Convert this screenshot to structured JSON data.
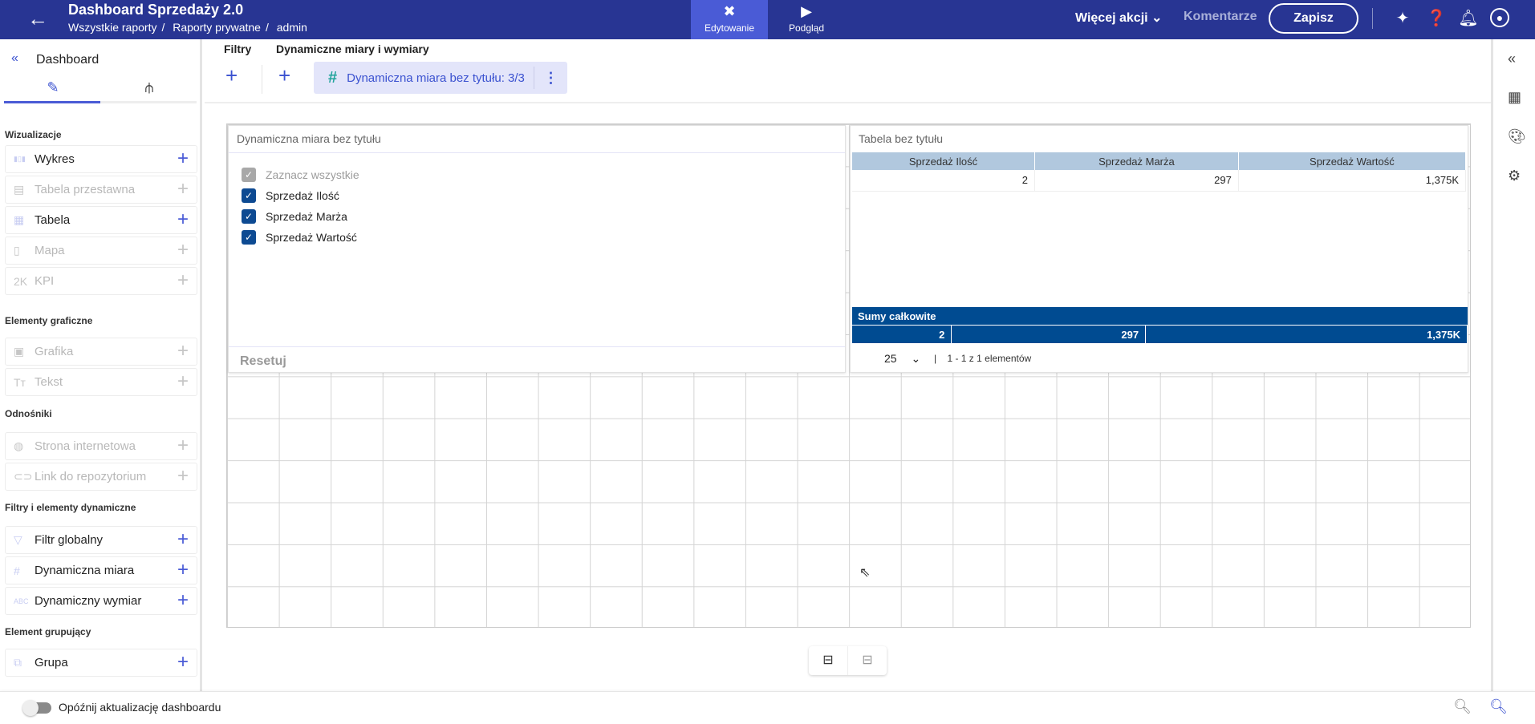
{
  "header": {
    "title": "Dashboard Sprzedaży 2.0",
    "breadcrumb": [
      "Wszystkie raporty",
      "Raporty prywatne",
      "admin"
    ],
    "tabs": [
      {
        "label": "Edytowanie",
        "icon": "edit-tools-icon"
      },
      {
        "label": "Podgląd",
        "icon": "play-icon"
      }
    ],
    "more_actions": "Więcej akcji",
    "comments": "Komentarze",
    "save": "Zapisz"
  },
  "sidebar": {
    "title": "Dashboard",
    "sections": [
      {
        "title": "Wizualizacje",
        "items": [
          {
            "label": "Wykres",
            "enabled": true
          },
          {
            "label": "Tabela przestawna",
            "enabled": false
          },
          {
            "label": "Tabela",
            "enabled": true
          },
          {
            "label": "Mapa",
            "enabled": false
          },
          {
            "label": "KPI",
            "enabled": false
          }
        ]
      },
      {
        "title": "Elementy graficzne",
        "items": [
          {
            "label": "Grafika",
            "enabled": false
          },
          {
            "label": "Tekst",
            "enabled": false
          }
        ]
      },
      {
        "title": "Odnośniki",
        "items": [
          {
            "label": "Strona internetowa",
            "enabled": false
          },
          {
            "label": "Link do repozytorium",
            "enabled": false
          }
        ]
      },
      {
        "title": "Filtry i elementy dynamiczne",
        "items": [
          {
            "label": "Filtr globalny",
            "enabled": true
          },
          {
            "label": "Dynamiczna miara",
            "enabled": true
          },
          {
            "label": "Dynamiczny wymiar",
            "enabled": true
          }
        ]
      },
      {
        "title": "Element grupujący",
        "items": [
          {
            "label": "Grupa",
            "enabled": true
          }
        ]
      }
    ]
  },
  "toolbar": {
    "filters_label": "Filtry",
    "dynamic_label": "Dynamiczne miary i wymiary",
    "chip": "Dynamiczna miara bez tytułu: 3/3"
  },
  "measure_panel": {
    "title": "Dynamiczna miara bez tytułu",
    "select_all": "Zaznacz wszystkie",
    "options": [
      "Sprzedaż Ilość",
      "Sprzedaż Marża",
      "Sprzedaż Wartość"
    ],
    "reset": "Resetuj"
  },
  "table_panel": {
    "title": "Tabela bez tytułu",
    "columns": [
      "Sprzedaż Ilość",
      "Sprzedaż Marża",
      "Sprzedaż Wartość"
    ],
    "rows": [
      [
        "2",
        "297",
        "1,375K"
      ]
    ],
    "totals_label": "Sumy całkowite",
    "totals": [
      "2",
      "297",
      "1,375K"
    ],
    "page_size": "25",
    "pagination": "1 - 1 z 1 elementów"
  },
  "footer": {
    "toggle_label": "Opóźnij aktualizację dashboardu"
  }
}
